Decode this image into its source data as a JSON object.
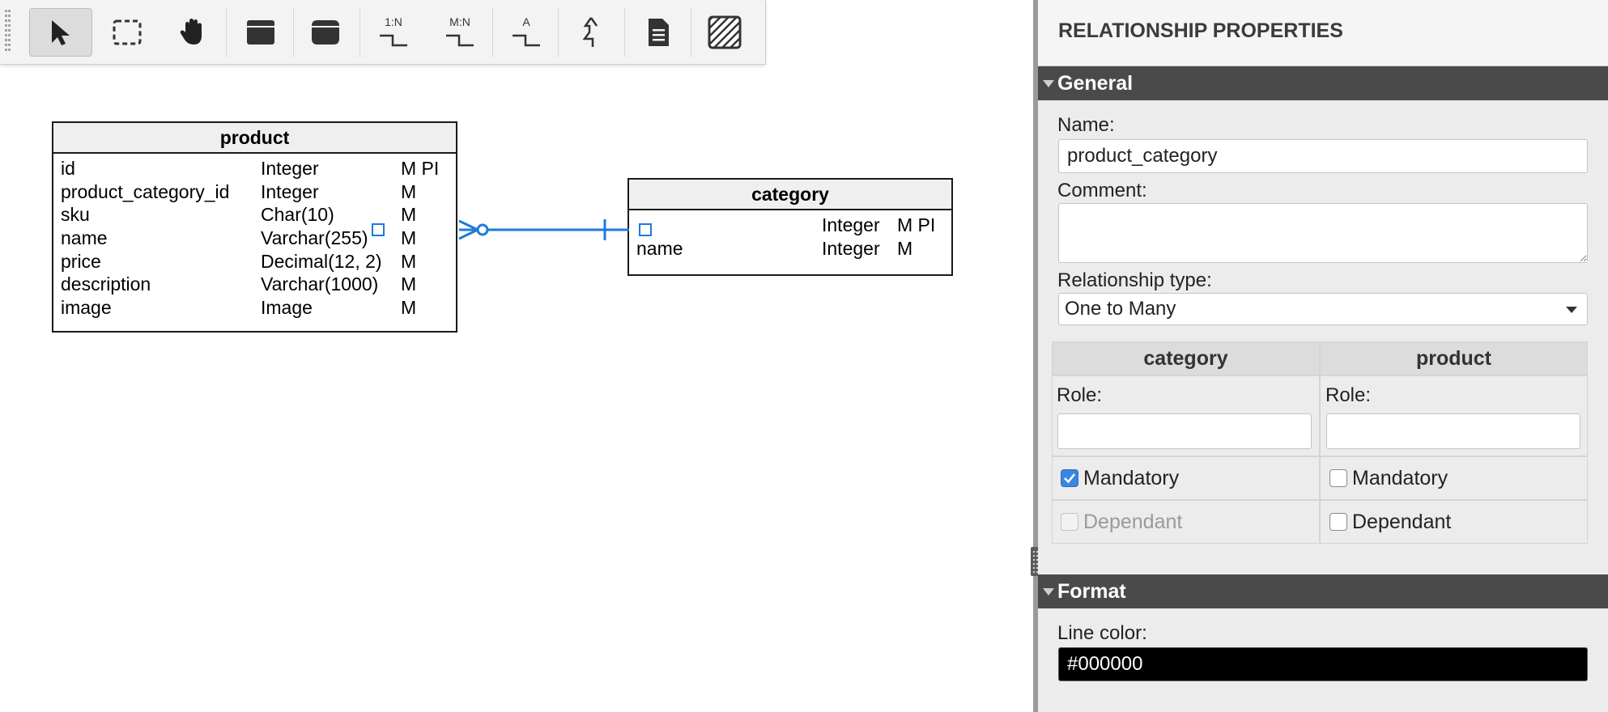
{
  "toolbar": {
    "tools": [
      {
        "name": "select-tool",
        "icon": "pointer-arrow-icon",
        "active": true
      },
      {
        "name": "marquee-tool",
        "icon": "dashed-rectangle-icon",
        "active": false
      },
      {
        "name": "pan-tool",
        "icon": "hand-icon",
        "active": false
      },
      {
        "name": "new-entity-tool",
        "icon": "entity-box-icon",
        "active": false
      },
      {
        "name": "new-view-tool",
        "icon": "view-box-icon",
        "active": false
      },
      {
        "name": "one-to-many-tool",
        "icon": "one-to-many-icon",
        "glyph": "1:N",
        "active": false
      },
      {
        "name": "many-to-many-tool",
        "icon": "many-to-many-icon",
        "glyph": "M:N",
        "active": false
      },
      {
        "name": "identifying-relation-tool",
        "icon": "relation-a-icon",
        "glyph": "A",
        "active": false
      },
      {
        "name": "inheritance-tool",
        "icon": "inheritance-arrow-icon",
        "active": false
      },
      {
        "name": "note-tool",
        "icon": "note-document-icon",
        "active": false
      },
      {
        "name": "area-tool",
        "icon": "hatched-area-icon",
        "active": false
      }
    ]
  },
  "diagram": {
    "product": {
      "title": "product",
      "attributes": [
        {
          "name": "id",
          "type": "Integer",
          "flags": "M PI"
        },
        {
          "name": "product_category_id",
          "type": "Integer",
          "flags": "M"
        },
        {
          "name": "sku",
          "type": "Char(10)",
          "flags": "M"
        },
        {
          "name": "name",
          "type": "Varchar(255)",
          "flags": "M"
        },
        {
          "name": "price",
          "type": "Decimal(12, 2)",
          "flags": "M"
        },
        {
          "name": "description",
          "type": "Varchar(1000)",
          "flags": "M"
        },
        {
          "name": "image",
          "type": "Image",
          "flags": "M"
        }
      ]
    },
    "category": {
      "title": "category",
      "attributes": [
        {
          "name": "",
          "type": "Integer",
          "flags": "M PI"
        },
        {
          "name": "name",
          "type": "Integer",
          "flags": "M"
        }
      ]
    },
    "relationship_color": "#1e7bd9"
  },
  "panel": {
    "title": "RELATIONSHIP PROPERTIES",
    "general": {
      "section_label": "General",
      "name_label": "Name:",
      "name_value": "product_category",
      "comment_label": "Comment:",
      "comment_value": "",
      "type_label": "Relationship type:",
      "type_value": "One to Many",
      "sides": [
        {
          "header": "category",
          "role_label": "Role:",
          "role_value": "",
          "mandatory_label": "Mandatory",
          "mandatory": true,
          "dependant_label": "Dependant",
          "dependant": false,
          "dependant_disabled": true
        },
        {
          "header": "product",
          "role_label": "Role:",
          "role_value": "",
          "mandatory_label": "Mandatory",
          "mandatory": false,
          "dependant_label": "Dependant",
          "dependant": false,
          "dependant_disabled": false
        }
      ]
    },
    "format": {
      "section_label": "Format",
      "line_color_label": "Line color:",
      "line_color_value": "#000000"
    }
  }
}
